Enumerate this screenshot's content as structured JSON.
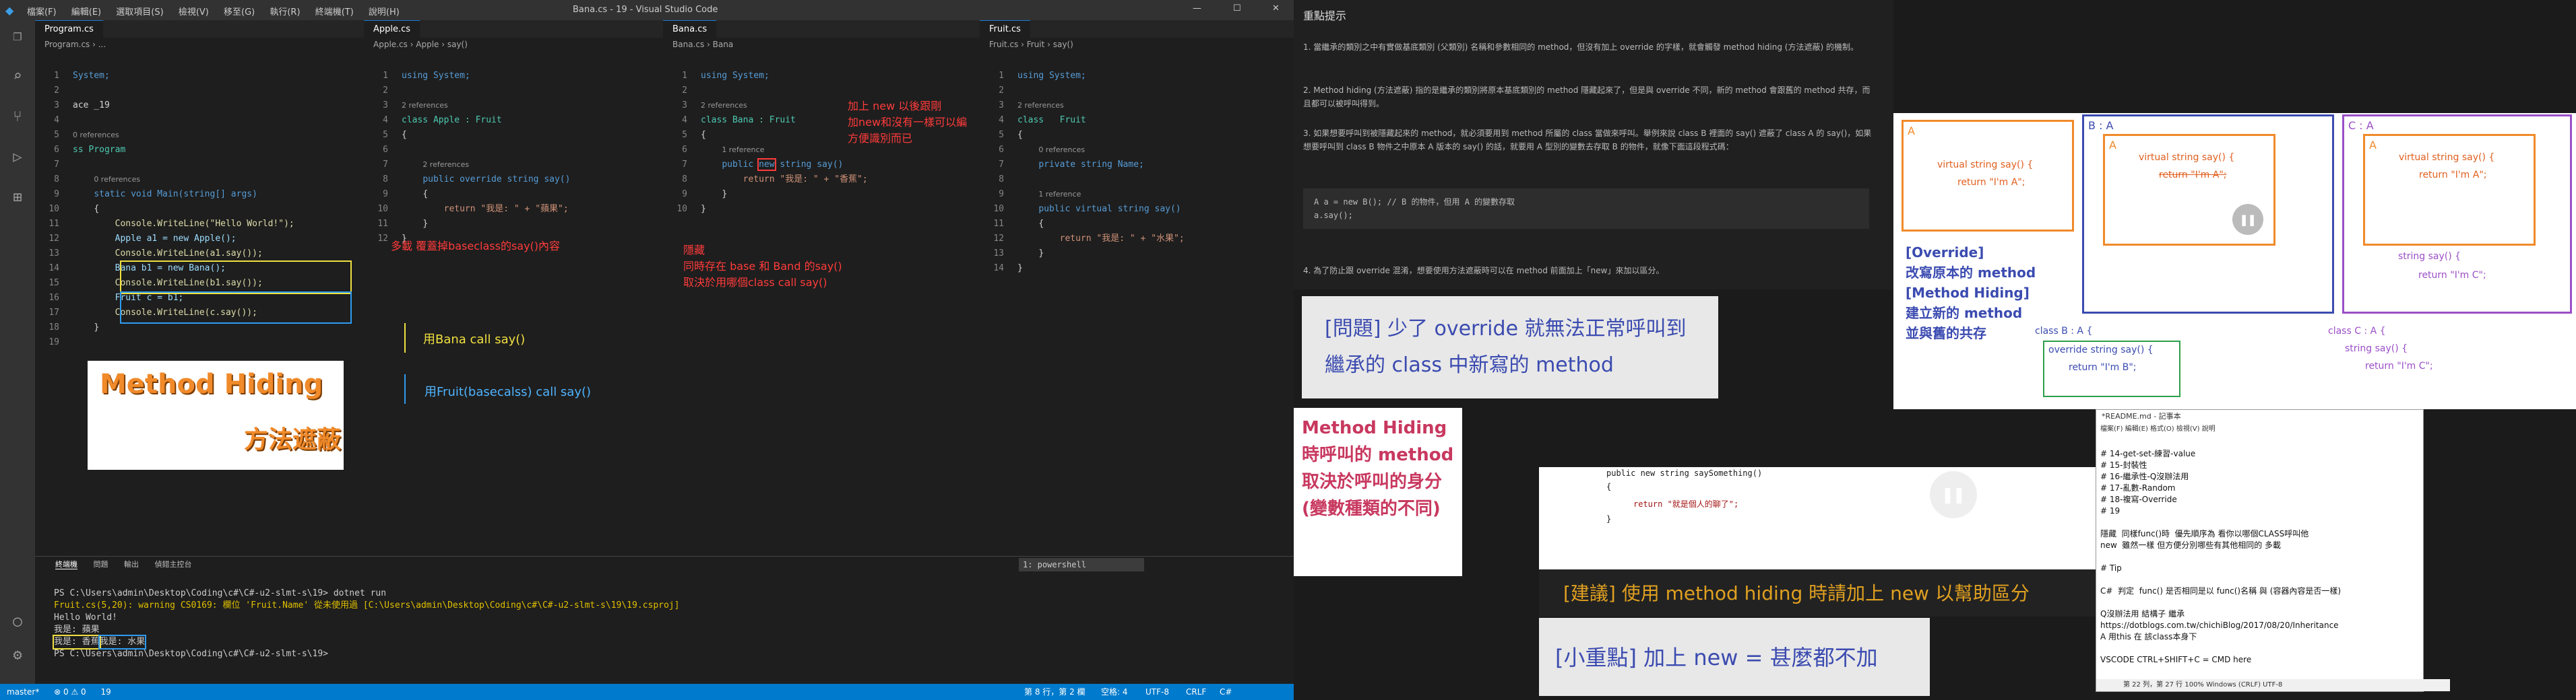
{
  "titlebar": {
    "menu": [
      "檔案(F)",
      "編輯(E)",
      "選取項目(S)",
      "檢視(V)",
      "移至(G)",
      "執行(R)",
      "終端機(T)",
      "說明(H)"
    ],
    "title": "Bana.cs - 19 - Visual Studio Code"
  },
  "panes": {
    "program": {
      "tab": "Program.cs",
      "crumb": "Program.cs › ...",
      "lines": [
        "System;",
        "",
        "ace _19",
        "",
        "0 references",
        "ss Program",
        "",
        "0 references",
        "static void Main(string[] args)",
        "{",
        "Console.WriteLine(\"Hello World!\");",
        "Apple a1 = new Apple();",
        "Console.WriteLine(a1.say());",
        "Bana b1 = new Bana();",
        "Console.WriteLine(b1.say());",
        "Fruit c = b1;",
        "Console.WriteLine(c.say());",
        "}",
        "",
        "",
        ""
      ],
      "numbers": [
        "1",
        "2",
        "3",
        "4",
        "5",
        "6",
        "7",
        "8",
        "9",
        "10",
        "11",
        "12",
        "13",
        "14",
        "15",
        "16",
        "17",
        "18",
        "19"
      ]
    },
    "apple": {
      "tab": "Apple.cs",
      "crumb": "Apple.cs › Apple › say()"
    },
    "bana": {
      "tab": "Bana.cs",
      "crumb": "Bana.cs › Bana"
    },
    "fruit": {
      "tab": "Fruit.cs",
      "crumb": "Fruit.cs › Fruit › say()"
    }
  },
  "code": {
    "using": "using System;",
    "refs2": "2 references",
    "refs1": "1 reference",
    "refs0": "0 references",
    "apple_class": "class Apple : Fruit",
    "apple_method": "public override string say()",
    "apple_return": "return \"我是: \" + \"蘋果\";",
    "bana_class": "class Bana : Fruit",
    "bana_method_kw": "public",
    "bana_new": "new",
    "bana_method_rest": "string say()",
    "bana_return": "return \"我是: \" + \"香蕉\";",
    "fruit_class": "class   Fruit",
    "fruit_field": "private string Name;",
    "fruit_method": "public virtual string say()",
    "fruit_return": "return \"我是: \" + \"水果\";",
    "brace_open": "{",
    "brace_close": "}"
  },
  "annotations": {
    "title_big": "Method Hiding",
    "title_sub": "方法遮蔽",
    "multi_cover": "多載 覆蓋掉baseclass的say()內容",
    "add_new": "加上 new 以後跟剛\n加new和沒有一樣可以編\n方便識別而已",
    "hidden": "隱藏\n同時存在 base 和 Band 的say()\n取決於用哪個class call say()",
    "bana_call": "用Bana call say()",
    "fruit_call": "用Fruit(basecalss) call say()"
  },
  "terminal": {
    "tabs": [
      "終端機",
      "問題",
      "輸出",
      "偵錯主控台"
    ],
    "shell": "1: powershell",
    "lines": [
      "PS C:\\Users\\admin\\Desktop\\Coding\\c#\\C#-u2-slmt-s\\19> dotnet run",
      "Fruit.cs(5,20): warning CS0169: 欄位 'Fruit.Name' 從未使用過 [C:\\Users\\admin\\Desktop\\Coding\\c#\\C#-u2-slmt-s\\19\\19.csproj]",
      "Hello World!",
      "我是: 蘋果",
      "我是: 香蕉",
      "我是: 水果",
      "PS C:\\Users\\admin\\Desktop\\Coding\\c#\\C#-u2-slmt-s\\19> "
    ]
  },
  "statusbar": {
    "branch": "master*",
    "errors": "⊗ 0 ⚠ 0",
    "count": "19",
    "pos": "第 8 行，第 2 欄",
    "spaces": "空格: 4",
    "enc": "UTF-8",
    "eol": "CRLF",
    "lang": "C#"
  },
  "right": {
    "doc_title": "重點提示",
    "doc_p1": "1. 當繼承的類別之中有實做基底類別 (父類別) 名稱和參數相同的 method，但沒有加上 override 的字樣，就會觸發 method hiding (方法遮蔽) 的機制。",
    "doc_p2": "2. Method hiding (方法遮蔽) 指的是繼承的類別將原本基底類別的 method 隱藏起來了，但是與 override 不同，新的 method 會跟舊的 method 共存，而且都可以被呼叫得到。",
    "doc_p3": "3. 如果想要呼叫到被隱藏起來的 method，就必須要用到 method 所屬的 class 當做來呼叫。舉例來說 class B 裡面的 say() 遮蔽了 class A 的 say()，如果想要呼叫到 class B 物件之中原本 A 版本的 say() 的話，就要用 A 型別的變數去存取 B 的物件，就像下面這段程式碼：",
    "doc_code1": "A a = new B(); // B 的物件，但用 A 的變數存取",
    "doc_code2": "a.say();",
    "doc_p4": "4. 為了防止跟 override 混淆，想要使用方法遮蔽時可以在 method 前面加上「new」來加以區分。",
    "q_text": "[問題] 少了 override 就無法正常呼叫到繼承的 class 中新寫的 method",
    "mh_text": "Method Hiding 時呼叫的 method 取決於呼叫的身分 (變數種類的不同)",
    "code_line": "public new string saySomething()",
    "code_ret": "return \"就是個人的聊了\";",
    "suggest": "[建議] 使用 method hiding 時請加上 new 以幫助區分",
    "point": "[小重點] 加上 new = 甚麼都不加",
    "diag_a": "A",
    "diag_ba": "B : A",
    "diag_ca": "C : A",
    "say_a": "virtual string say() {",
    "ret_a": "return \"I'm A\";",
    "ret_c": "return \"I'm C\";",
    "string_say": "string say() {",
    "override_label": "[Override]",
    "override_desc": "改寫原本的 method",
    "hiding_label": "[Method Hiding]",
    "hiding_desc": "建立新的 method",
    "coexist": "並與舊的共存",
    "classb": "class B : A {",
    "classc": "class C : A {",
    "override_say": "override string say() {",
    "ret_b": "return \"I'm B\";",
    "notepad_title": "*README.md - 記事本",
    "notepad_menu": "檔案(F)  編輯(E)  格式(O)  檢視(V)  說明",
    "notepad_lines": [
      "# 14-get-set-練習-value",
      "# 15-封裝性",
      "# 16-繼承性-Q沒辦法用",
      "# 17-亂數-Random",
      "# 18-複寫-Override",
      "# 19",
      "",
      "隱藏  同樣func()時  優先順序為 看你以哪個CLASS呼叫他",
      "new  雖然一樣 但方便分別哪些有其他相同的 多載",
      "",
      "# Tip",
      "",
      "C#  判定  func() 是否相同是以 func()名稱 與 (容器內容是否一樣)",
      "",
      "Q沒辦法用 結構子 繼承",
      "https://dotblogs.com.tw/chichiBlog/2017/08/20/Inheritance",
      "A 用this 在 該class本身下",
      "",
      "VSCODE CTRL+SHIFT+C = CMD here"
    ],
    "notepad_status": "第 22 列，第 27 行    100%    Windows (CRLF)    UTF-8"
  }
}
